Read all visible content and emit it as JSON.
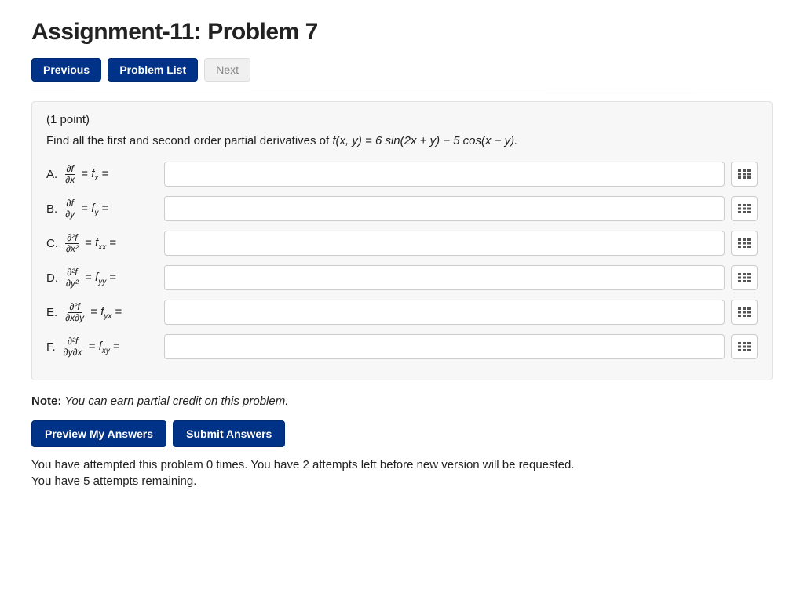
{
  "title": "Assignment-11: Problem 7",
  "nav": {
    "previous": "Previous",
    "problem_list": "Problem List",
    "next": "Next"
  },
  "points_label": "(1 point)",
  "prompt_prefix": "Find all the first and second order partial derivatives of ",
  "prompt_fn": "f(x, y) = 6 sin(2x + y) − 5 cos(x − y).",
  "questions": [
    {
      "letter": "A.",
      "num": "∂f",
      "den": "∂x",
      "sub": "x"
    },
    {
      "letter": "B.",
      "num": "∂f",
      "den": "∂y",
      "sub": "y"
    },
    {
      "letter": "C.",
      "num": "∂²f",
      "den": "∂x²",
      "sub": "xx"
    },
    {
      "letter": "D.",
      "num": "∂²f",
      "den": "∂y²",
      "sub": "yy"
    },
    {
      "letter": "E.",
      "num": "∂²f",
      "den": "∂x∂y",
      "sub": "yx"
    },
    {
      "letter": "F.",
      "num": "∂²f",
      "den": "∂y∂x",
      "sub": "xy"
    }
  ],
  "note_label": "Note:",
  "note_text": " You can earn partial credit on this problem.",
  "actions": {
    "preview": "Preview My Answers",
    "submit": "Submit Answers"
  },
  "status": {
    "line1": "You have attempted this problem 0 times. You have 2 attempts left before new version will be requested.",
    "line2": "You have 5 attempts remaining."
  }
}
